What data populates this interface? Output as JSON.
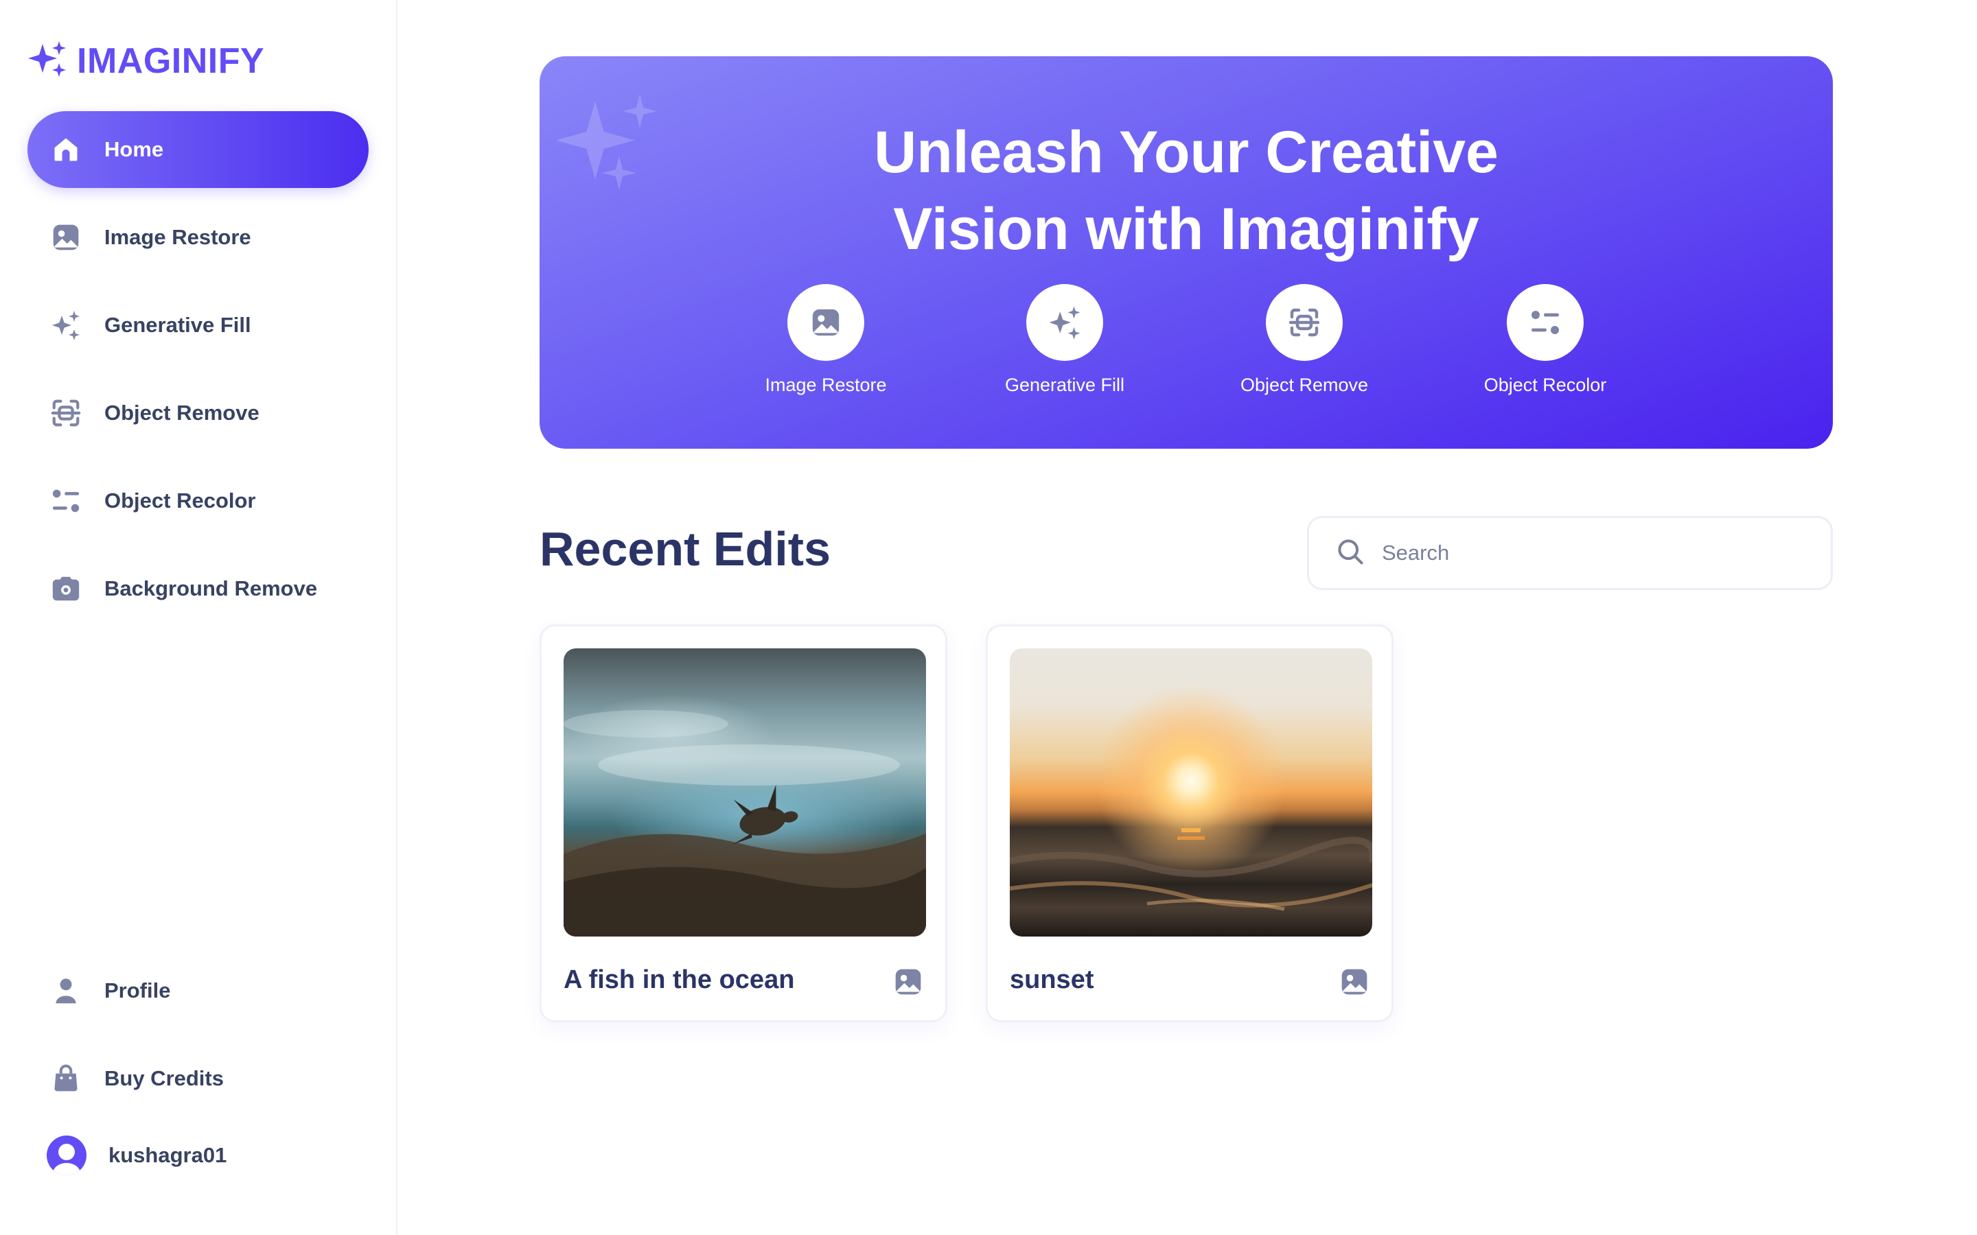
{
  "app": {
    "name": "IMAGINIFY",
    "brand_color": "#624cf5"
  },
  "sidebar": {
    "items": [
      {
        "label": "Home",
        "icon": "home-icon",
        "active": true
      },
      {
        "label": "Image Restore",
        "icon": "image-icon"
      },
      {
        "label": "Generative Fill",
        "icon": "sparkles-icon"
      },
      {
        "label": "Object Remove",
        "icon": "scan-icon"
      },
      {
        "label": "Object Recolor",
        "icon": "filter-icon"
      },
      {
        "label": "Background Remove",
        "icon": "camera-icon"
      }
    ],
    "bottom": [
      {
        "label": "Profile",
        "icon": "profile-icon"
      },
      {
        "label": "Buy Credits",
        "icon": "bag-icon"
      }
    ],
    "user": {
      "name": "kushagra01"
    }
  },
  "hero": {
    "title_line1": "Unleash Your Creative",
    "title_line2": "Vision with Imaginify",
    "tools": [
      {
        "label": "Image Restore",
        "icon": "image-icon"
      },
      {
        "label": "Generative Fill",
        "icon": "sparkles-icon"
      },
      {
        "label": "Object Remove",
        "icon": "scan-icon"
      },
      {
        "label": "Object Recolor",
        "icon": "filter-icon"
      }
    ]
  },
  "recent": {
    "title": "Recent Edits",
    "search_placeholder": "Search",
    "cards": [
      {
        "title": "A fish in the ocean",
        "icon": "image-icon"
      },
      {
        "title": "sunset",
        "icon": "image-icon"
      }
    ]
  }
}
